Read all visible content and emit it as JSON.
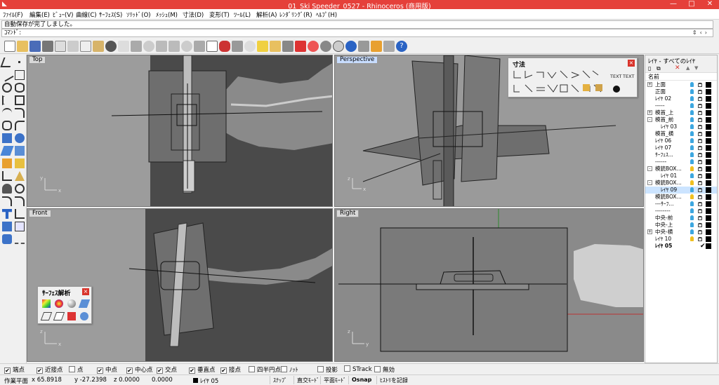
{
  "window": {
    "title": "01_Ski Speeder_0527 - Rhinoceros (商用版)"
  },
  "colors": {
    "titlebar": "#e5403a",
    "accent": "#d9342b",
    "viewport_bg": "#9a9a9a",
    "selection": "#cce4ff",
    "active_tab": "#c8ddff"
  },
  "menu": [
    "ﾌｧｲﾙ(F)",
    "編集(E)",
    "ﾋﾞｭｰ(V)",
    "曲線(C)",
    "ｻｰﾌｪｽ(S)",
    "ｿﾘｯﾄﾞ(O)",
    "ﾒｯｼｭ(M)",
    "寸法(D)",
    "変形(T)",
    "ﾂｰﾙ(L)",
    "解析(A)",
    "ﾚﾝﾀﾞﾘﾝｸﾞ(R)",
    "ﾍﾙﾌﾟ(H)"
  ],
  "command": {
    "history": "自動保存が完了しました。",
    "prompt": "ｺﾏﾝﾄﾞ:",
    "value": ""
  },
  "viewports": {
    "top": "Top",
    "perspective": "Perspective",
    "front": "Front",
    "right": "Right"
  },
  "panels": {
    "dimension": {
      "title": "寸法",
      "text1": "TEXT",
      "text2": "TEXT"
    },
    "surface_analysis": {
      "title": "ｻｰﾌｪｽ解析"
    }
  },
  "layers": {
    "title": "ﾚｲﾔ - すべてのﾚｲﾔ",
    "column_name": "名前",
    "rows": [
      {
        "name": "上面",
        "pm": "+",
        "indent": 0,
        "bulb": "#3da7e0"
      },
      {
        "name": "正面",
        "pm": "",
        "indent": 0,
        "bulb": "#3da7e0"
      },
      {
        "name": "ﾚｲﾔ 02",
        "pm": "",
        "indent": 0,
        "bulb": "#3da7e0"
      },
      {
        "name": "-----",
        "pm": "",
        "indent": 0,
        "bulb": "#3da7e0"
      },
      {
        "name": "模首_上",
        "pm": "+",
        "indent": 0,
        "bulb": "#3da7e0"
      },
      {
        "name": "模首_前",
        "pm": "-",
        "indent": 0,
        "bulb": "#3da7e0"
      },
      {
        "name": "ﾚｲﾔ 03",
        "pm": "",
        "indent": 1,
        "bulb": "#3da7e0"
      },
      {
        "name": "模首_横",
        "pm": "",
        "indent": 0,
        "bulb": "#3da7e0"
      },
      {
        "name": "ﾚｲﾔ 06",
        "pm": "",
        "indent": 0,
        "bulb": "#3da7e0"
      },
      {
        "name": "ﾚｲﾔ 07",
        "pm": "",
        "indent": 0,
        "bulb": "#3da7e0"
      },
      {
        "name": "ｻｰﾌｪｽ...",
        "pm": "",
        "indent": 0,
        "bulb": "#3da7e0"
      },
      {
        "name": "------",
        "pm": "",
        "indent": 0,
        "bulb": "#3da7e0"
      },
      {
        "name": "模銃BOX...",
        "pm": "-",
        "indent": 0,
        "bulb": "#f0c020"
      },
      {
        "name": "ﾚｲﾔ 01",
        "pm": "",
        "indent": 1,
        "bulb": "#3da7e0"
      },
      {
        "name": "模銃BOX...",
        "pm": "-",
        "indent": 0,
        "bulb": "#f0c020"
      },
      {
        "name": "ﾚｲﾔ 09",
        "pm": "",
        "indent": 1,
        "bulb": "#3da7e0",
        "selected": true
      },
      {
        "name": "模銃BOX...",
        "pm": "",
        "indent": 0,
        "bulb": "#f0c020"
      },
      {
        "name": "---ｻｰﾌ...",
        "pm": "",
        "indent": 0,
        "bulb": "#3da7e0"
      },
      {
        "name": "--------",
        "pm": "",
        "indent": 0,
        "bulb": "#3da7e0"
      },
      {
        "name": "中央-前",
        "pm": "",
        "indent": 0,
        "bulb": "#3da7e0"
      },
      {
        "name": "中央-上",
        "pm": "",
        "indent": 0,
        "bulb": "#3da7e0"
      },
      {
        "name": "中央-横",
        "pm": "+",
        "indent": 0,
        "bulb": "#3da7e0"
      },
      {
        "name": "ﾚｲﾔ 10",
        "pm": "",
        "indent": 0,
        "bulb": "#f0c020"
      },
      {
        "name": "ﾚｲﾔ 05",
        "pm": "",
        "indent": 0,
        "bulb": "",
        "current": true
      }
    ]
  },
  "osnaps": [
    {
      "label": "端点",
      "checked": true
    },
    {
      "label": "近接点",
      "checked": true
    },
    {
      "label": "点",
      "checked": false
    },
    {
      "label": "中点",
      "checked": true
    },
    {
      "label": "中心点",
      "checked": true
    },
    {
      "label": "交点",
      "checked": true
    },
    {
      "label": "垂直点",
      "checked": true
    },
    {
      "label": "接点",
      "checked": true
    },
    {
      "label": "四半円点",
      "checked": false
    },
    {
      "label": "ﾉｯﾄ",
      "checked": false
    },
    {
      "label": "投影",
      "checked": false
    },
    {
      "label": "STrack",
      "checked": false
    },
    {
      "label": "無効",
      "checked": false
    }
  ],
  "status": {
    "cplane": "作業平面",
    "x": "x 65.8918",
    "y": "y -27.2398",
    "z": "z 0.0000",
    "extra": "0.0000",
    "layer": "ﾚｲﾔ 05",
    "snap": "ｽﾅｯﾌﾟ",
    "ortho": "直交ﾓｰﾄﾞ",
    "planar": "平面ﾓｰﾄﾞ",
    "osnap": "Osnap",
    "history": "ﾋｽﾄﾘを記録"
  }
}
